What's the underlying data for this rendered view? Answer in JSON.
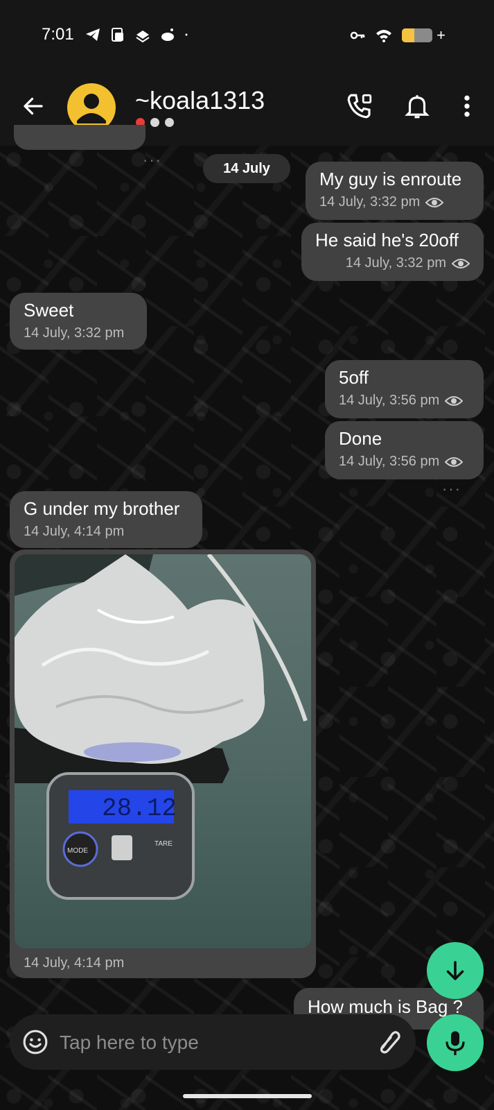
{
  "status_bar": {
    "time": "7:01"
  },
  "header": {
    "contact_name": "~koala1313",
    "icons": [
      "back-arrow-icon",
      "avatar-icon",
      "call-icon",
      "notifications-icon",
      "more-options-icon"
    ]
  },
  "chat": {
    "date_chip": "14 July",
    "messages": [
      {
        "direction": "out",
        "text": "My guy is enroute",
        "time": "14 July, 3:32 pm"
      },
      {
        "direction": "out",
        "text": "He said he's 20off",
        "time": "14 July, 3:32 pm"
      },
      {
        "direction": "in",
        "text": "Sweet",
        "time": "14 July, 3:32 pm"
      },
      {
        "direction": "out",
        "text": "5off",
        "time": "14 July, 3:56 pm"
      },
      {
        "direction": "out",
        "text": "Done",
        "time": "14 July, 3:56 pm"
      },
      {
        "direction": "in",
        "text": "G under my brother",
        "time": "14 July, 4:14 pm"
      },
      {
        "direction": "in",
        "type": "image",
        "scale_reading": "28.12",
        "scale_left_button": "MODE",
        "scale_right_button": "TARE",
        "time": "14 July, 4:14 pm"
      },
      {
        "direction": "out",
        "text": "How much is Bag ?"
      }
    ]
  },
  "composer": {
    "placeholder": "Tap here to type"
  },
  "colors": {
    "accent": "#3ad294",
    "avatar": "#f3c130",
    "bubble": "#444444",
    "background": "#111111"
  }
}
